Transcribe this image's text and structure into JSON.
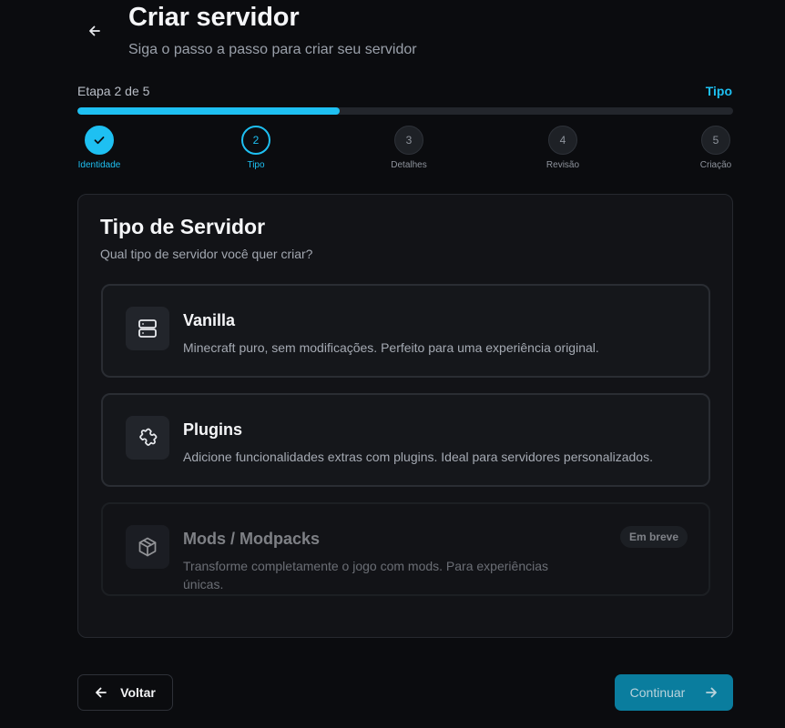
{
  "header": {
    "title": "Criar servidor",
    "subtitle": "Siga o passo a passo para criar seu servidor",
    "back_icon": "arrow-left-icon"
  },
  "progress": {
    "step_text": "Etapa 2 de 5",
    "current_label": "Tipo",
    "fraction": 0.4,
    "accent_color": "#1ec0f2"
  },
  "steps": [
    {
      "number": "1",
      "label": "Identidade",
      "state": "done",
      "icon": "check-icon"
    },
    {
      "number": "2",
      "label": "Tipo",
      "state": "active"
    },
    {
      "number": "3",
      "label": "Detalhes",
      "state": "pending"
    },
    {
      "number": "4",
      "label": "Revisão",
      "state": "pending"
    },
    {
      "number": "5",
      "label": "Criação",
      "state": "pending"
    }
  ],
  "card": {
    "title": "Tipo de Servidor",
    "subtitle": "Qual tipo de servidor você quer criar?",
    "options": [
      {
        "title": "Vanilla",
        "description": "Minecraft puro, sem modificações. Perfeito para uma experiência original.",
        "icon": "server-icon"
      },
      {
        "title": "Plugins",
        "description": "Adicione funcionalidades extras com plugins. Ideal para servidores personalizados.",
        "icon": "puzzle-icon"
      },
      {
        "title": "Mods / Modpacks",
        "description": "Transforme completamente o jogo com mods. Para experiências únicas.",
        "icon": "package-icon",
        "badge": "Em breve",
        "disabled": true
      }
    ]
  },
  "footer": {
    "back_label": "Voltar",
    "continue_label": "Continuar"
  }
}
